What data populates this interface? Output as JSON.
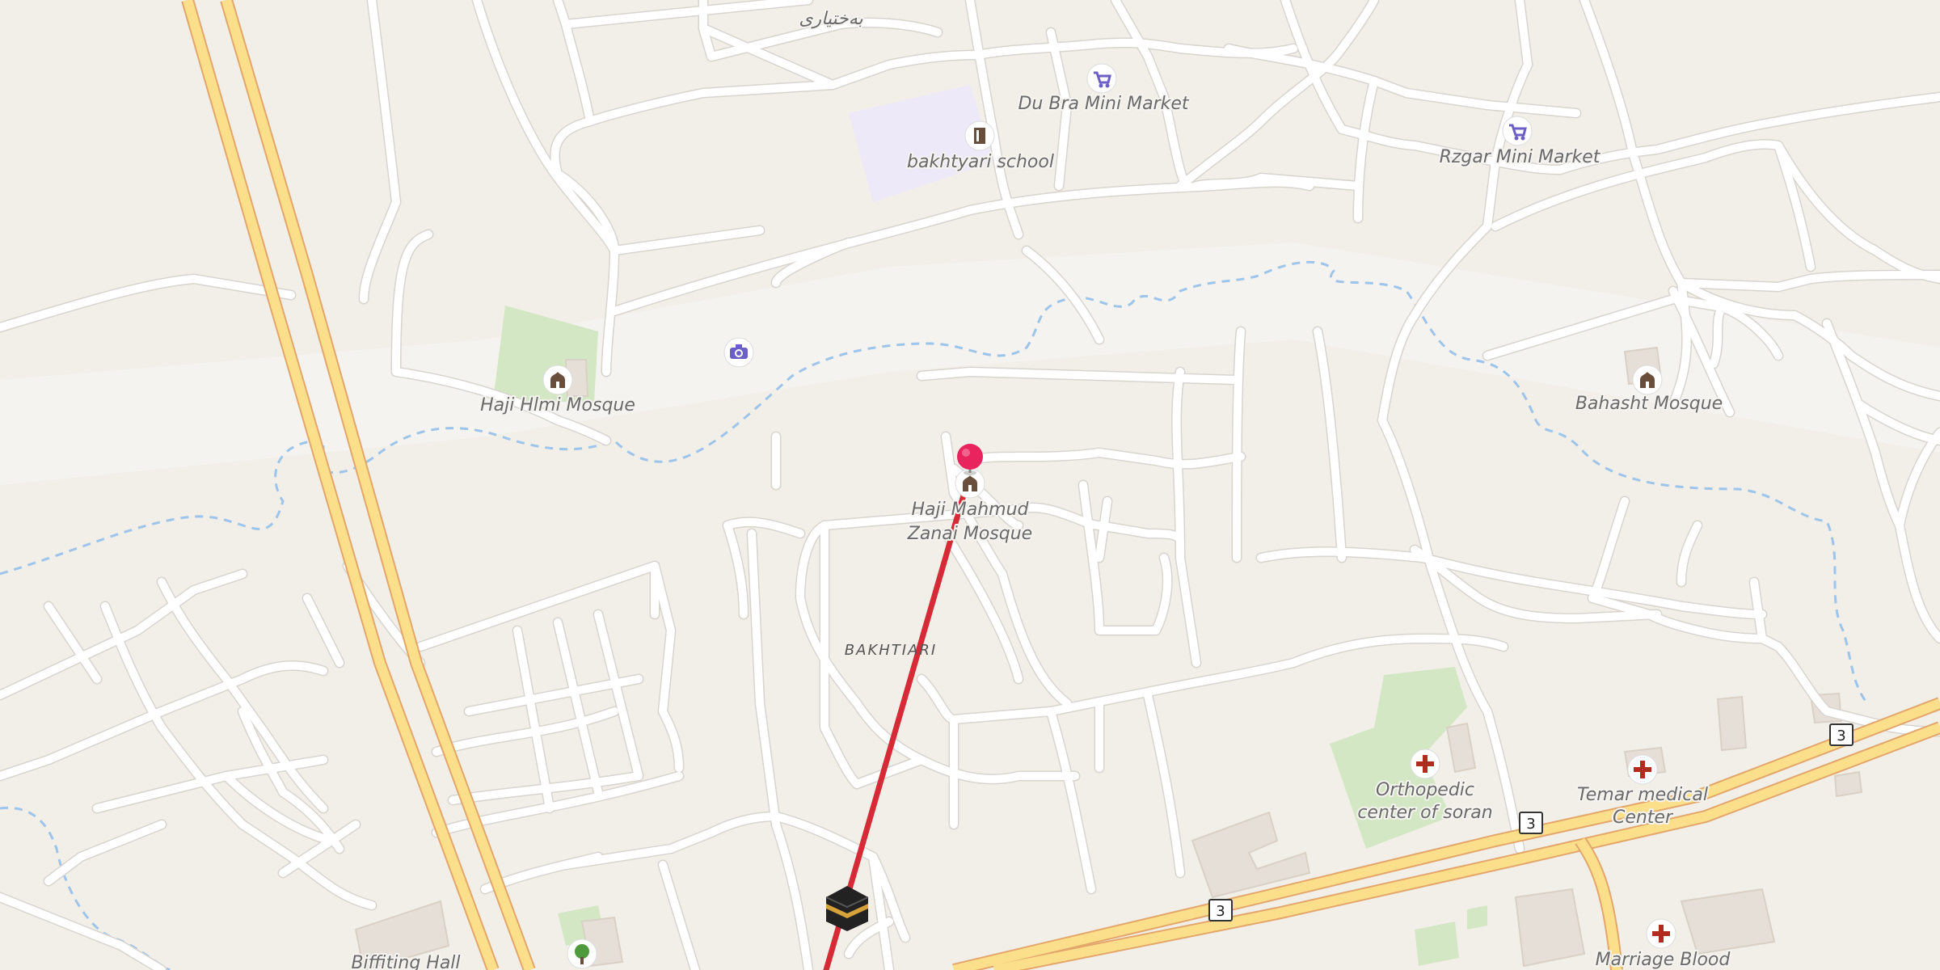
{
  "map": {
    "colors": {
      "land": "#f2efe9",
      "minor_road": "#ffffff",
      "trunk_road": "#fcdf8a",
      "trunk_casing": "#e3a66b",
      "stream": "#9dc4ea",
      "park": "#d4e7c5",
      "school": "#ede9f8",
      "building": "#e6dfd7",
      "route_line": "#d62b36",
      "pin": "#e8235d",
      "shop_icon": "#6b5ec7",
      "health_icon": "#b22b1f",
      "place_icon": "#6a4e3c"
    },
    "labels": {
      "top_arabic": "بەختیاری",
      "du_bra": "Du Bra Mini Market",
      "school": "bakhtyari school",
      "rzgar": "Rzgar Mini Market",
      "haji_hlmi": "Haji Hlmi Mosque",
      "bahasht": "Bahasht Mosque",
      "haji_mahmud_1": "Haji Mahmud",
      "haji_mahmud_2": "Zanai Mosque",
      "district": "BAKHTIARI",
      "ortho_1": "Orthopedic",
      "ortho_2": "center of soran",
      "temar_1": "Temar medical",
      "temar_2": "Center",
      "biffiting": "Biffiting Hall",
      "marriage": "Marriage Blood"
    },
    "route_shield": "3",
    "icons": {
      "shop_1": "shopping-cart-icon",
      "shop_2": "shopping-cart-icon",
      "school": "school-icon",
      "camera": "camera-icon",
      "mosque_1": "mosque-icon",
      "mosque_2": "mosque-icon",
      "mosque_3": "mosque-icon",
      "hospital_1": "hospital-icon",
      "hospital_2": "hospital-icon",
      "hospital_3": "hospital-icon",
      "kaaba": "kaaba-icon",
      "tree": "tree-icon",
      "pin": "location-pin-icon"
    }
  }
}
